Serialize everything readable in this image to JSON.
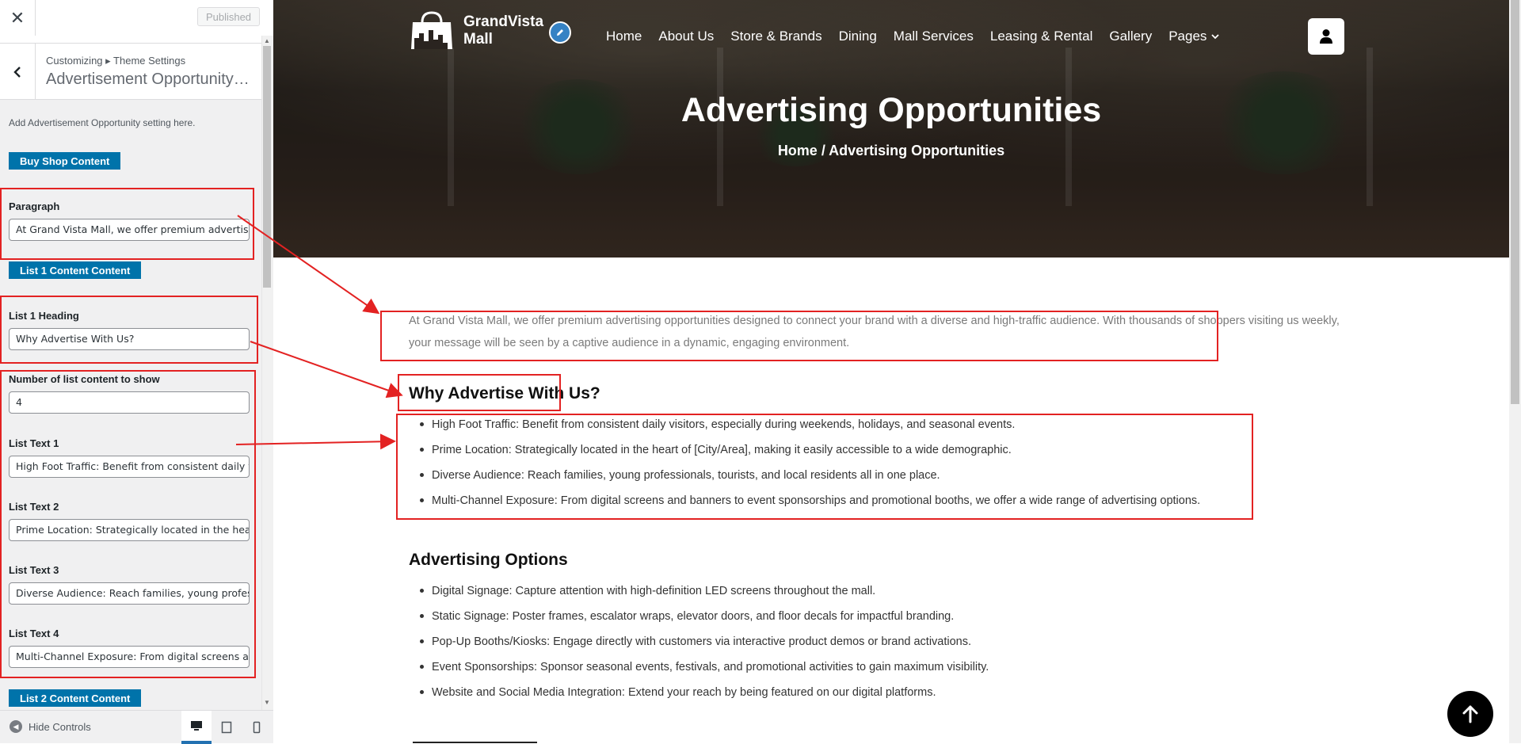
{
  "customizer": {
    "close_label": "✕",
    "published_label": "Published",
    "breadcrumb": "Customizing ▸ Theme Settings",
    "section_title": "Advertisement Opportunity P...",
    "description": "Add Advertisement Opportunity setting here.",
    "buy_button": "Buy Shop Content",
    "paragraph_label": "Paragraph",
    "paragraph_value": "At Grand Vista Mall, we offer premium advertising opportunities designed to connect your brand",
    "list1_button": "List 1 Content Content",
    "list1_heading_label": "List 1 Heading",
    "list1_heading_value": "Why Advertise With Us?",
    "number_label": "Number of list content to show",
    "number_value": "4",
    "list_texts": [
      {
        "label": "List Text 1",
        "value": "High Foot Traffic: Benefit from consistent daily visitors"
      },
      {
        "label": "List Text 2",
        "value": "Prime Location: Strategically located in the heart of"
      },
      {
        "label": "List Text 3",
        "value": "Diverse Audience: Reach families, young professionals"
      },
      {
        "label": "List Text 4",
        "value": "Multi-Channel Exposure: From digital screens and banners"
      }
    ],
    "list2_button": "List 2 Content Content",
    "hide_controls": "Hide Controls"
  },
  "site": {
    "logo_text_line1": "GrandVista",
    "logo_text_line2": "Mall",
    "nav": [
      "Home",
      "About Us",
      "Store & Brands",
      "Dining",
      "Mall Services",
      "Leasing & Rental",
      "Gallery",
      "Pages"
    ],
    "hero_title": "Advertising Opportunities",
    "hero_breadcrumb": "Home / Advertising Opportunities",
    "intro": "At Grand Vista Mall, we offer premium advertising opportunities designed to connect your brand with a diverse and high-traffic audience. With thousands of shoppers visiting us weekly, your message will be seen by a captive audience in a dynamic, engaging environment.",
    "why_heading": "Why Advertise With Us?",
    "why_list": [
      "High Foot Traffic: Benefit from consistent daily visitors, especially during weekends, holidays, and seasonal events.",
      "Prime Location: Strategically located in the heart of [City/Area], making it easily accessible to a wide demographic.",
      "Diverse Audience: Reach families, young professionals, tourists, and local residents all in one place.",
      "Multi-Channel Exposure: From digital screens and banners to event sponsorships and promotional booths, we offer a wide range of advertising options."
    ],
    "options_heading": "Advertising Options",
    "options_list": [
      "Digital Signage: Capture attention with high-definition LED screens throughout the mall.",
      "Static Signage: Poster frames, escalator wraps, elevator doors, and floor decals for impactful branding.",
      "Pop-Up Booths/Kiosks: Engage directly with customers via interactive product demos or brand activations.",
      "Event Sponsorships: Sponsor seasonal events, festivals, and promotional activities to gain maximum visibility.",
      "Website and Social Media Integration: Extend your reach by being featured on our digital platforms."
    ]
  },
  "colors": {
    "wp_blue": "#0073aa",
    "annotation_red": "#e32222"
  }
}
